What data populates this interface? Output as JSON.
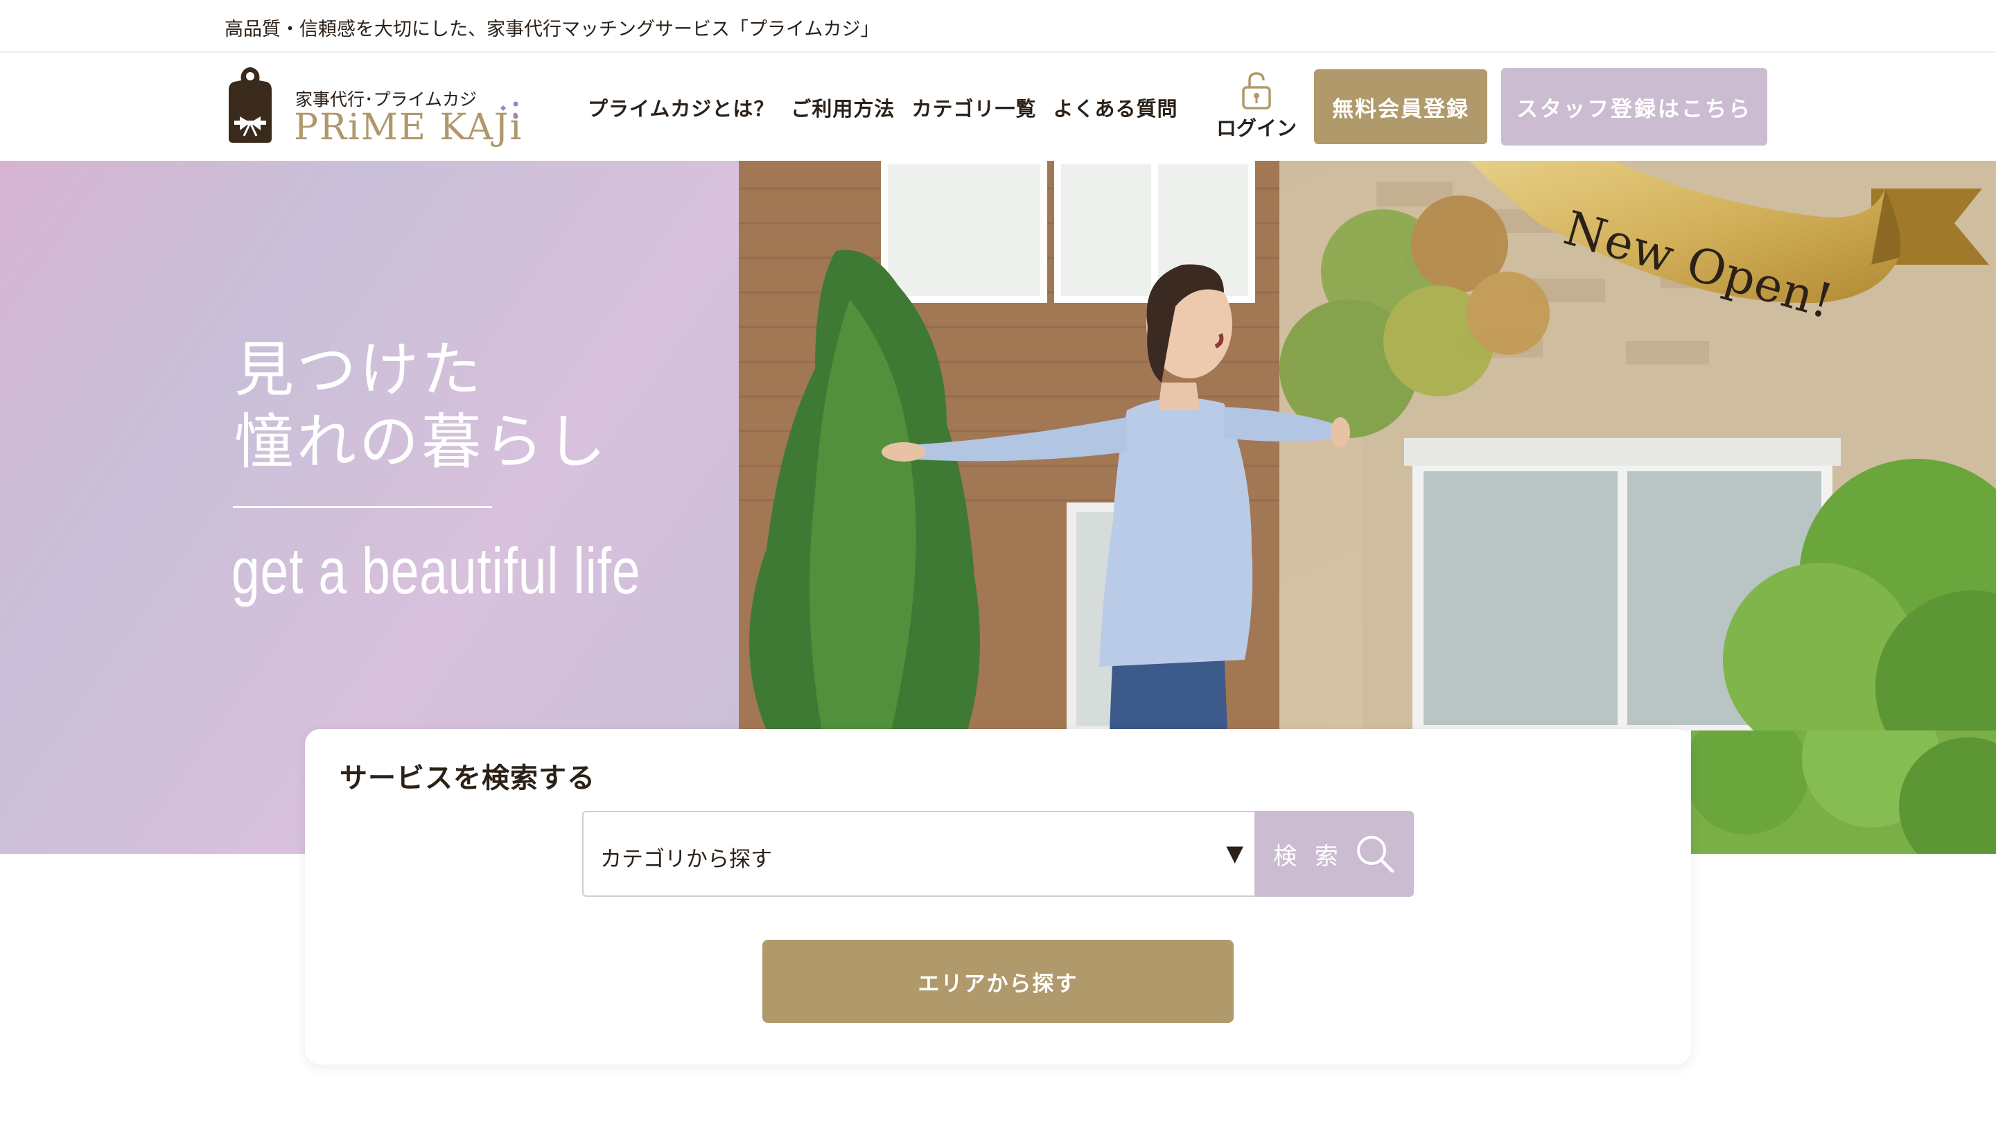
{
  "tagline": "高品質・信頼感を大切にした、家事代行マッチングサービス「プライムカジ」",
  "logo": {
    "sub": "家事代行･プライムカジ",
    "main": "PRiME KAJi",
    "icon": "apron-logo-icon"
  },
  "nav": {
    "items": [
      {
        "label": "プライムカジとは？"
      },
      {
        "label": "ご利用方法"
      },
      {
        "label": "カテゴリ一覧"
      },
      {
        "label": "よくある質問"
      }
    ],
    "login_label": "ログイン",
    "login_icon": "lock-icon",
    "register_label": "無料会員登録",
    "staff_label": "スタッフ登録はこちら"
  },
  "hero": {
    "headline_line1": "見つけた",
    "headline_line2": "憧れの暮らし",
    "subline": "get a beautiful life",
    "ribbon_text": "New Open!"
  },
  "search": {
    "title": "サービスを検索する",
    "category_select": "カテゴリから探す",
    "search_button": "検 索",
    "search_icon": "search-icon",
    "area_button": "エリアから探す"
  },
  "colors": {
    "accent_gold": "#b09a6b",
    "accent_lavender": "#cbbcd2",
    "hero_gradient_pink": "#d6b4d1",
    "hero_gradient_lilac": "#c9bfd8",
    "text": "#2b2118"
  }
}
